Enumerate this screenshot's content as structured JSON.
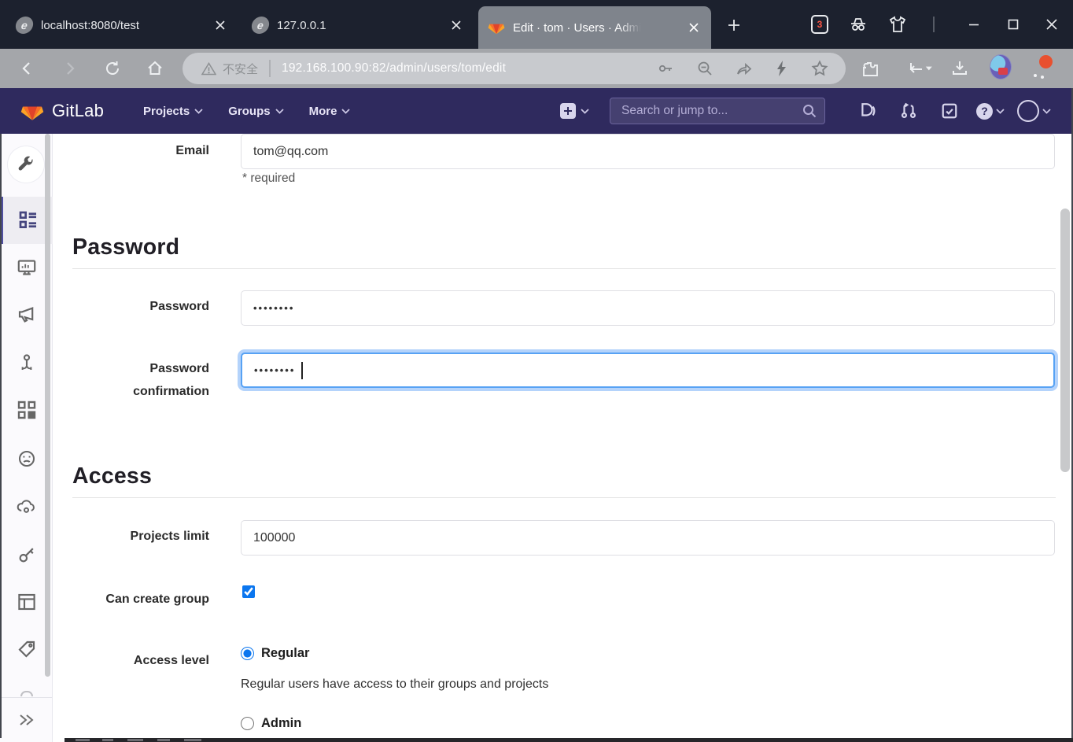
{
  "titlebar": {
    "tabs": [
      {
        "title": "localhost:8080/test",
        "active": false
      },
      {
        "title": "127.0.0.1",
        "active": false
      },
      {
        "title": "Edit · tom · Users · Admi",
        "active": true
      }
    ],
    "extension_badge_count": "3"
  },
  "toolbar": {
    "security_label": "不安全",
    "url": "192.168.100.90:82/admin/users/tom/edit"
  },
  "navbar": {
    "brand": "GitLab",
    "menus": [
      {
        "label": "Projects"
      },
      {
        "label": "Groups"
      },
      {
        "label": "More"
      }
    ],
    "search_placeholder": "Search or jump to...",
    "help_glyph": "?"
  },
  "sidebar": {
    "items": [
      "admin-area-wrench",
      "overview (active)",
      "monitoring",
      "messages",
      "system-hooks",
      "applications",
      "abuse-reports",
      "kubernetes",
      "deploy-keys",
      "service-templates",
      "labels",
      "collapse-sidebar"
    ]
  },
  "form": {
    "email": {
      "label": "Email",
      "value": "tom@qq.com",
      "help": "* required"
    },
    "password_section_title": "Password",
    "password": {
      "label": "Password",
      "value": "••••••••"
    },
    "password_confirmation": {
      "label_line1": "Password",
      "label_line2": "confirmation",
      "value": "••••••••"
    },
    "access_section_title": "Access",
    "projects_limit": {
      "label": "Projects limit",
      "value": "100000"
    },
    "can_create_group": {
      "label": "Can create group",
      "checked": true
    },
    "access_level": {
      "label": "Access level",
      "options": [
        {
          "label": "Regular",
          "description": "Regular users have access to their groups and projects",
          "selected": true
        },
        {
          "label": "Admin",
          "selected": false
        }
      ]
    }
  },
  "colors": {
    "titlebar_bg": "#1c212e",
    "active_tab_bg": "#7f848c",
    "toolbar_bg": "#a4a6aa",
    "gitlab_navbar_bg": "#2f2a5e",
    "sidebar_active_accent": "#504fa1",
    "focus_blue": "#57a2f4",
    "control_blue": "#0b76ef",
    "notification_badge": "#e8502f",
    "tanuki_red": "#e24329",
    "tanuki_orange": "#fc6d26",
    "tanuki_light": "#fca326"
  }
}
